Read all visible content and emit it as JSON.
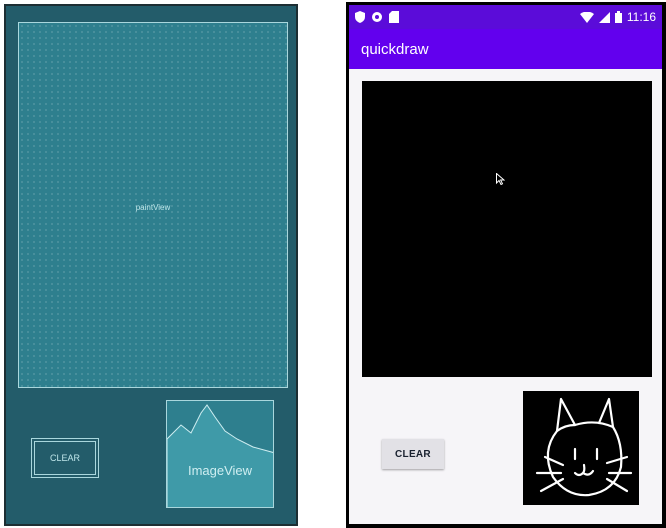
{
  "blueprint": {
    "paint_view_label": "paintView",
    "clear_label": "CLEAR",
    "image_view_label": "ImageView"
  },
  "device": {
    "status_bar": {
      "time": "11:16",
      "background_color": "#5b0cd9",
      "left_icons": [
        "shield-icon",
        "settings-icon",
        "sd-card-icon"
      ],
      "right_icons": [
        "wifi-icon",
        "signal-icon",
        "battery-icon"
      ]
    },
    "app_bar": {
      "title": "quickdraw",
      "color": "#6200ee"
    },
    "clear_button_label": "CLEAR",
    "canvas_color": "#000000"
  }
}
